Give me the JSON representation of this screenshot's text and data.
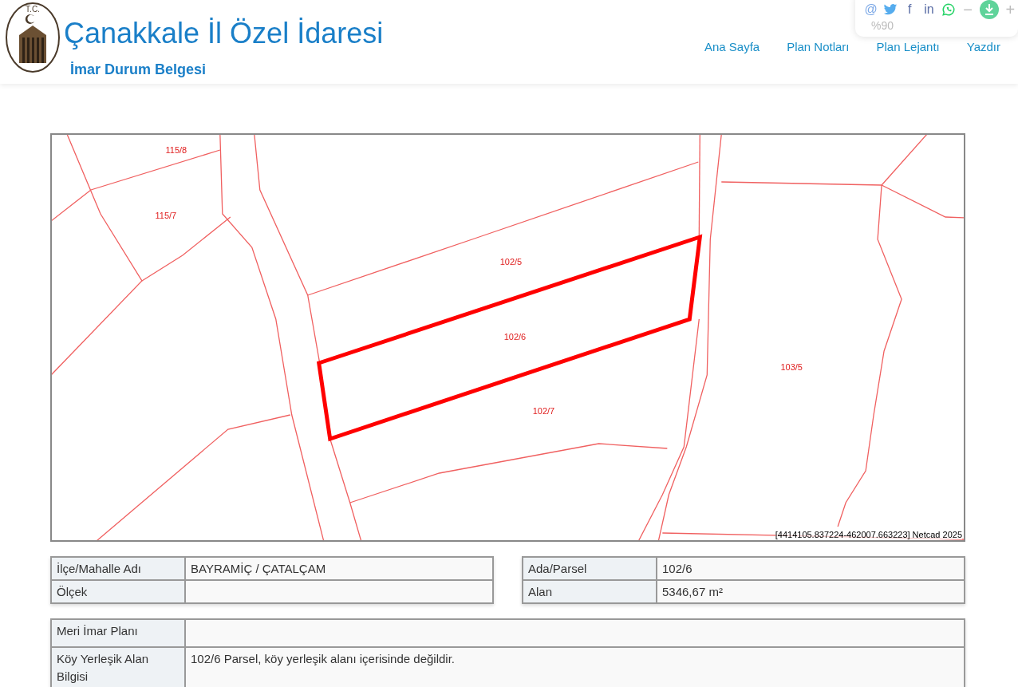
{
  "header": {
    "logo_caption": "T.C.",
    "title": "Çanakkale İl Özel İdaresi",
    "subtitle": "İmar Durum Belgesi"
  },
  "nav": [
    {
      "label": "Ana Sayfa"
    },
    {
      "label": "Plan Notları"
    },
    {
      "label": "Plan Lejantı"
    },
    {
      "label": "Yazdır"
    }
  ],
  "toolbar": {
    "buttons": [
      {
        "kind": "glyph",
        "glyph": "@"
      },
      {
        "kind": "twitter"
      },
      {
        "kind": "glyph",
        "glyph": "f"
      },
      {
        "kind": "glyph",
        "glyph": "in"
      },
      {
        "kind": "whatsapp"
      },
      {
        "kind": "glyph",
        "glyph": "−"
      },
      {
        "kind": "download"
      },
      {
        "kind": "glyph",
        "glyph": "+"
      }
    ],
    "zoom": "%90"
  },
  "map": {
    "parcels": [
      {
        "label": "115/8"
      },
      {
        "label": "115/7"
      },
      {
        "label": "102/5"
      },
      {
        "label": "102/6"
      },
      {
        "label": "102/7"
      },
      {
        "label": "103/5"
      }
    ],
    "credit": "[4414105.837224-462007.663223] Netcad 2025"
  },
  "info_tables": [
    {
      "rows": [
        {
          "label": "İlçe/Mahalle Adı",
          "value": "BAYRAMİÇ / ÇATALÇAM"
        },
        {
          "label": "Ölçek",
          "value": ""
        }
      ]
    },
    {
      "rows": [
        {
          "label": "Ada/Parsel",
          "value": "102/6"
        },
        {
          "label": "Alan",
          "value": "5346,67 m²"
        }
      ]
    }
  ],
  "details": {
    "rows": [
      {
        "label": "Meri İmar Planı",
        "value": ""
      },
      {
        "label": "Köy Yerleşik Alan Bilgisi",
        "value": "102/6 Parsel, köy yerleşik alanı içerisinde değildir."
      }
    ]
  }
}
